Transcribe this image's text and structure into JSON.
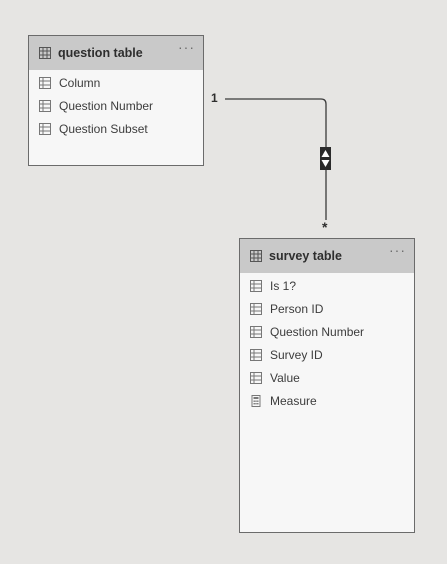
{
  "tables": {
    "question": {
      "title": "question table",
      "menu": "···",
      "fields": [
        {
          "label": "Column",
          "icon": "table-column-icon"
        },
        {
          "label": "Question Number",
          "icon": "table-column-icon"
        },
        {
          "label": "Question Subset",
          "icon": "table-column-icon"
        }
      ]
    },
    "survey": {
      "title": "survey table",
      "menu": "···",
      "fields": [
        {
          "label": "Is 1?",
          "icon": "table-column-icon"
        },
        {
          "label": "Person ID",
          "icon": "table-column-icon"
        },
        {
          "label": "Question Number",
          "icon": "table-column-icon"
        },
        {
          "label": "Survey ID",
          "icon": "table-column-icon"
        },
        {
          "label": "Value",
          "icon": "table-column-icon"
        },
        {
          "label": "Measure",
          "icon": "calculator-icon"
        }
      ]
    }
  },
  "relationship": {
    "from_cardinality": "1",
    "to_cardinality": "*",
    "direction": "both",
    "icon": "bidirectional-filter-icon"
  },
  "colors": {
    "canvas": "#e6e5e3",
    "header": "#c9c9c9",
    "card": "#f7f7f7",
    "line": "#3a3a3a"
  }
}
